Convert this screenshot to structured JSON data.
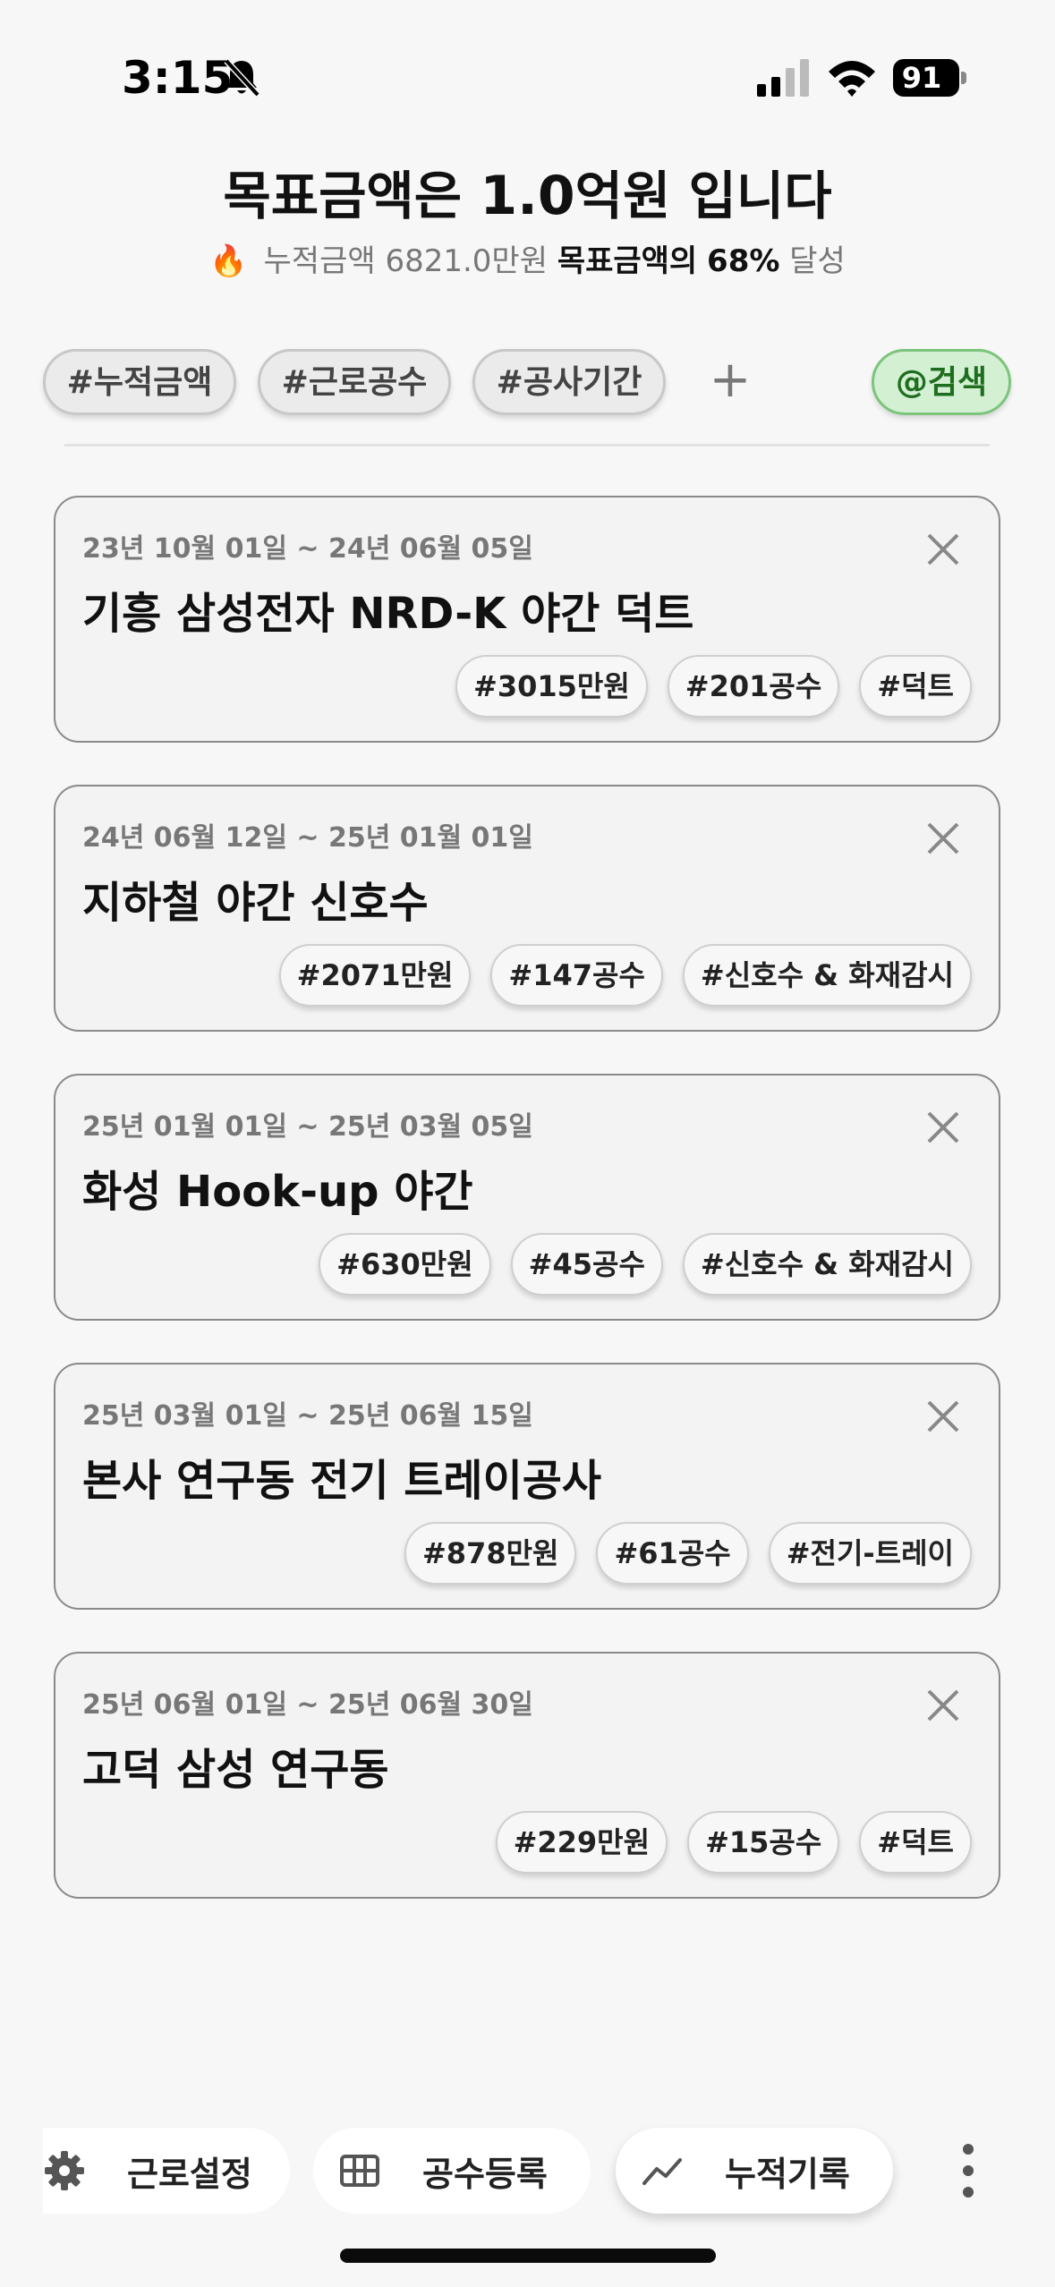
{
  "status_bar": {
    "time": "3:15",
    "battery": "91",
    "icons": [
      "bell-off-icon",
      "signal-icon",
      "wifi-icon",
      "battery-icon"
    ]
  },
  "header": {
    "goal_prefix": "목표금액은 ",
    "goal_amount": "1.0",
    "goal_suffix": "억원 입니다",
    "fire": "🔥",
    "cumulative_text": "누적금액 6821.0만원",
    "achievement_label": "목표금액의",
    "achievement_percent": "68%",
    "achievement_suffix": "달성"
  },
  "filters": {
    "chips": [
      "#누적금액",
      "#근로공수",
      "#공사기간"
    ],
    "add_label": "+",
    "search_label": "@검색",
    "search_color": "#d3f0d3"
  },
  "projects": [
    {
      "period": "23년 10월 01일 ~ 24년 06월 05일",
      "title": "기흥 삼성전자 NRD-K 야간 덕트",
      "tags": [
        "#3015만원",
        "#201공수",
        "#덕트"
      ]
    },
    {
      "period": "24년 06월 12일 ~ 25년 01월 01일",
      "title": "지하철 야간 신호수",
      "tags": [
        "#2071만원",
        "#147공수",
        "#신호수 & 화재감시"
      ]
    },
    {
      "period": "25년 01월 01일 ~ 25년 03월 05일",
      "title": "화성 Hook-up 야간",
      "tags": [
        "#630만원",
        "#45공수",
        "#신호수 & 화재감시"
      ]
    },
    {
      "period": "25년 03월 01일 ~ 25년 06월 15일",
      "title": "본사 연구동 전기 트레이공사",
      "tags": [
        "#878만원",
        "#61공수",
        "#전기-트레이"
      ]
    },
    {
      "period": "25년 06월 01일 ~ 25년 06월 30일",
      "title": "고덕 삼성 연구동",
      "tags": [
        "#229만원",
        "#15공수",
        "#덕트"
      ]
    }
  ],
  "bottom_nav": {
    "settings_label": "근로설정",
    "register_label": "공수등록",
    "records_label": "누적기록",
    "icons": [
      "gear-icon",
      "grid-icon",
      "trend-line-icon",
      "more-vertical-icon"
    ]
  }
}
